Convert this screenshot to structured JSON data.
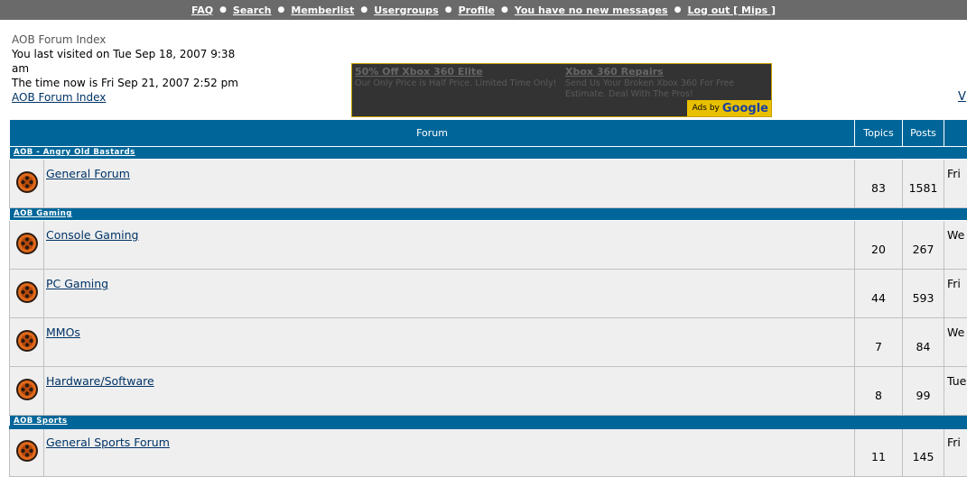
{
  "nav": {
    "items": [
      "FAQ",
      "Search",
      "Memberlist",
      "Usergroups",
      "Profile",
      "You have no new messages",
      "Log out [ Mips ]"
    ]
  },
  "header": {
    "breadcrumb": "AOB Forum Index",
    "last_visit": "You last visited on Tue Sep 18, 2007 9:38 am",
    "time_now": "The time now is Fri Sep 21, 2007 2:52 pm",
    "index_link": "AOB Forum Index"
  },
  "ad": {
    "ads": [
      {
        "title": "50% Off Xbox 360 Elite",
        "text": "Our Only Price is Half Price. Limited Time Only!"
      },
      {
        "title": "Xbox 360 Repairs",
        "text": "Send Us Your Broken Xbox 360 For Free Estimate. Deal With The Pros!"
      }
    ],
    "ads_by": "Ads by",
    "google": "Google"
  },
  "right_link": "V",
  "table": {
    "col_forum": "Forum",
    "col_topics": "Topics",
    "col_posts": "Posts",
    "categories": [
      {
        "name": "AOB - Angry Old Bastards",
        "forums": [
          {
            "name": "General Forum",
            "topics": "83",
            "posts": "1581",
            "last": "Fri"
          }
        ]
      },
      {
        "name": "AOB Gaming",
        "forums": [
          {
            "name": "Console Gaming",
            "topics": "20",
            "posts": "267",
            "last": "We"
          },
          {
            "name": "PC Gaming",
            "topics": "44",
            "posts": "593",
            "last": "Fri"
          },
          {
            "name": "MMOs",
            "topics": "7",
            "posts": "84",
            "last": "We"
          },
          {
            "name": "Hardware/Software",
            "topics": "8",
            "posts": "99",
            "last": "Tue"
          }
        ]
      },
      {
        "name": "AOB Sports",
        "forums": [
          {
            "name": "General Sports Forum",
            "topics": "11",
            "posts": "145",
            "last": "Fri"
          }
        ]
      }
    ]
  },
  "colors": {
    "header_blue": "#006699",
    "nav_gray": "#6a6a6a",
    "icon_orange": "#e06a1b",
    "ad_border": "#c8a000"
  }
}
